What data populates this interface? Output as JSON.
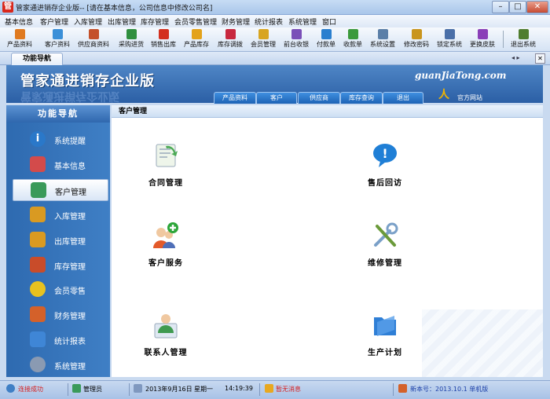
{
  "window": {
    "title": "管家通进销存企业版-- [请在基本信息，公司信息中修改公司名]",
    "app_icon_glyph": "管",
    "minimize_glyph": "–",
    "maximize_glyph": "□",
    "close_glyph": "✕"
  },
  "menu": [
    "基本信息",
    "客户管理",
    "入库管理",
    "出库管理",
    "库存管理",
    "会员零售管理",
    "财务管理",
    "统计报表",
    "系统管理",
    "窗口"
  ],
  "toolbar": [
    {
      "label": "产品资料",
      "icon": "product-icon",
      "color": "#e07a1f"
    },
    {
      "label": "客户资料",
      "icon": "customer-icon",
      "color": "#3a8fd8"
    },
    {
      "label": "供应商资料",
      "icon": "supplier-icon",
      "color": "#c4502a"
    },
    {
      "label": "采购进货",
      "icon": "purchase-icon",
      "color": "#2f8f3f"
    },
    {
      "label": "销售出库",
      "icon": "sales-icon",
      "color": "#d3301f"
    },
    {
      "label": "产品库存",
      "icon": "stock-icon",
      "color": "#e3a21a"
    },
    {
      "label": "库存调拨",
      "icon": "transfer-icon",
      "color": "#c8283f"
    },
    {
      "label": "会员管理",
      "icon": "member-icon",
      "color": "#d8a520"
    },
    {
      "label": "前台收银",
      "icon": "cashier-icon",
      "color": "#7a4fb8"
    },
    {
      "label": "付款单",
      "icon": "payment-icon",
      "color": "#2a7fcf"
    },
    {
      "label": "收款单",
      "icon": "receipt-icon",
      "color": "#3c9a3c"
    },
    {
      "label": "系统设置",
      "icon": "settings-icon",
      "color": "#5b7fa8"
    },
    {
      "label": "修改密码",
      "icon": "password-icon",
      "color": "#c9951d"
    },
    {
      "label": "锁定系统",
      "icon": "lock-icon",
      "color": "#4a6fa8"
    },
    {
      "label": "更换皮肤",
      "icon": "skin-icon",
      "color": "#8a3fb8"
    },
    {
      "label": "退出系统",
      "icon": "exit-icon",
      "color": "#4f7d2f"
    }
  ],
  "tabstrip": {
    "active_tab": "功能导航",
    "arrows": "◂ ▸",
    "close_glyph": "✕"
  },
  "banner": {
    "title": "管家通进销存企业版",
    "url": "guanJiaTong.com",
    "tabs": [
      "产品资料",
      "客户",
      "供应商",
      "库存查询",
      "退出"
    ],
    "site_label": "官方网站"
  },
  "sidebar": {
    "header": "功能导航",
    "items": [
      {
        "label": "系统提醒",
        "icon": "info-icon",
        "color": "#2a78c9"
      },
      {
        "label": "基本信息",
        "icon": "cubes-icon",
        "color": "#d34b4b"
      },
      {
        "label": "客户管理",
        "icon": "people-icon",
        "color": "#3a9a5a",
        "active": true
      },
      {
        "label": "入库管理",
        "icon": "inbox-icon",
        "color": "#d99a22"
      },
      {
        "label": "出库管理",
        "icon": "outbox-icon",
        "color": "#d99a22"
      },
      {
        "label": "库存管理",
        "icon": "house-icon",
        "color": "#c94c2a"
      },
      {
        "label": "会员零售",
        "icon": "member-icon",
        "color": "#e8c21f"
      },
      {
        "label": "财务管理",
        "icon": "finance-icon",
        "color": "#d4612a"
      },
      {
        "label": "统计报表",
        "icon": "report-icon",
        "color": "#3f86d6"
      },
      {
        "label": "系统管理",
        "icon": "gears-icon",
        "color": "#8a9ab2"
      }
    ]
  },
  "content": {
    "header": "客户管理",
    "functions": [
      {
        "label": "合同管理",
        "icon": "contract-icon",
        "color": "#4caa55"
      },
      {
        "label": "售后回访",
        "icon": "help-bubble-icon",
        "color": "#1f7fd6"
      },
      {
        "label": "客户服务",
        "icon": "customer-service-icon",
        "color": "#2da63a"
      },
      {
        "label": "维修管理",
        "icon": "tools-icon",
        "color": "#7aa0c8"
      },
      {
        "label": "联系人管理",
        "icon": "contacts-icon",
        "color": "#3f9a4f"
      },
      {
        "label": "生产计划",
        "icon": "folder-icon",
        "color": "#2f7fd6"
      }
    ]
  },
  "status": {
    "status_text": "连接成功",
    "user": "管理员",
    "date": "2013年9月16日",
    "weekday": "星期一",
    "time": "14:19:39",
    "message": "暂无消息",
    "version": "新本号：2013.10.1 单机版",
    "status_color": "#d61f1f",
    "message_color": "#d61f1f",
    "version_color": "#1b3fa8"
  }
}
